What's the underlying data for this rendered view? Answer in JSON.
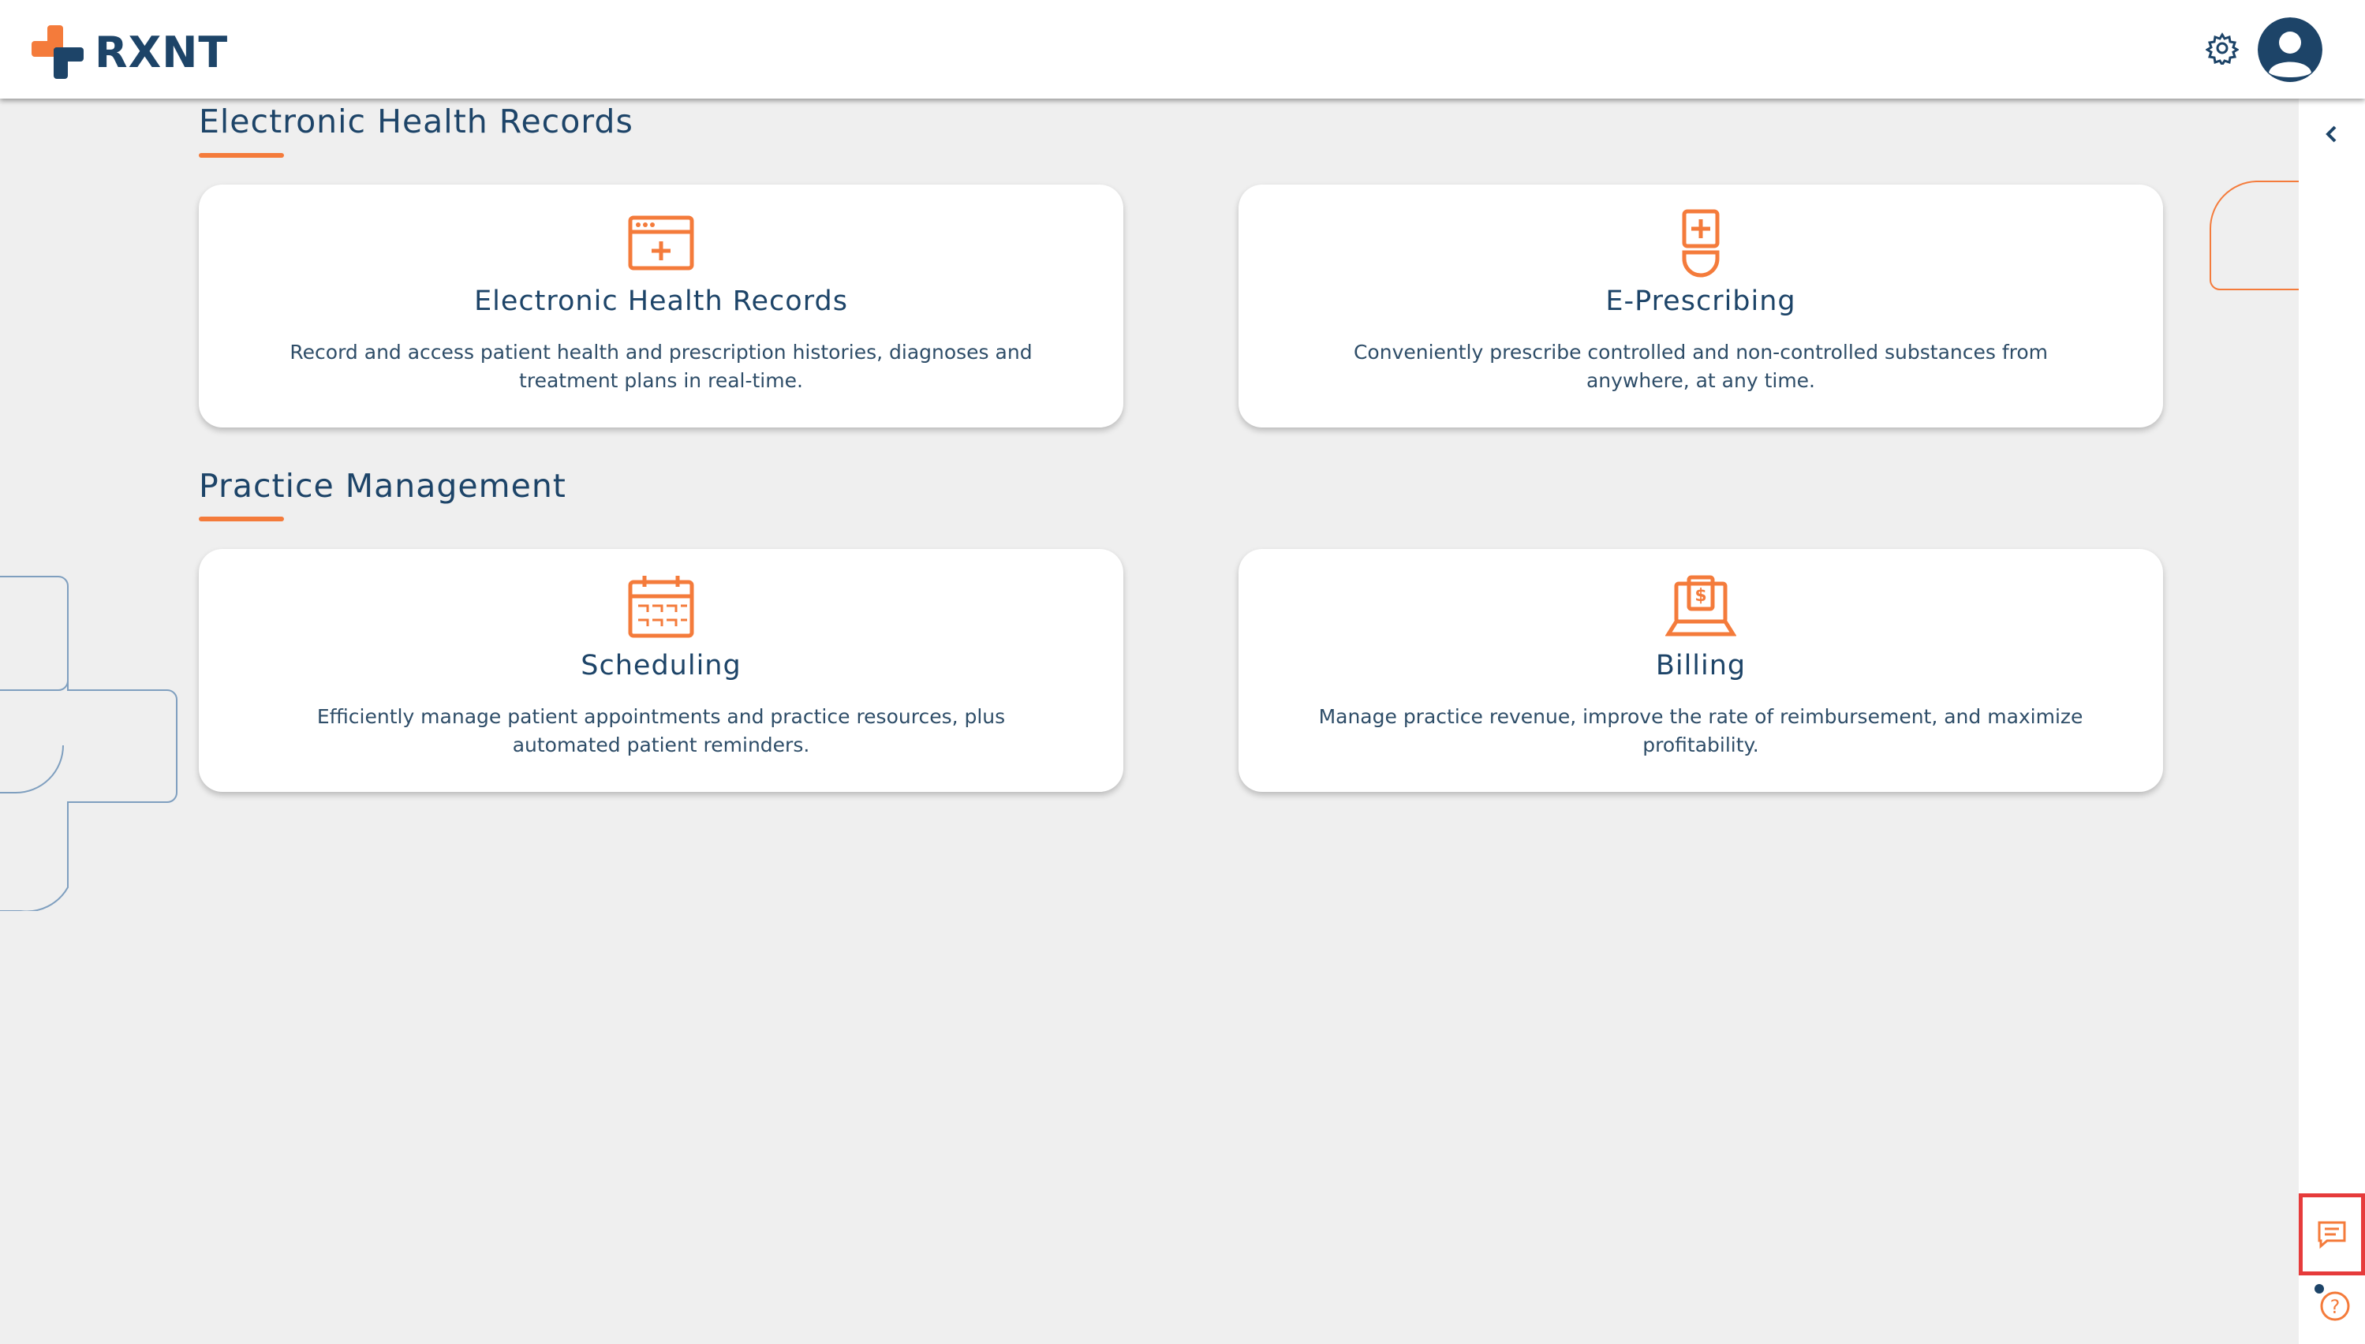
{
  "header": {
    "logo_text": "RXNT"
  },
  "sections": [
    {
      "title": "Electronic Health Records",
      "cards": [
        {
          "title": "Electronic Health Records",
          "description": "Record and access patient health and prescription histories, diagnoses and treatment plans in real-time.",
          "icon": "ehr-browser-icon"
        },
        {
          "title": "E-Prescribing",
          "description": "Conveniently prescribe controlled and non-controlled substances from anywhere, at any time.",
          "icon": "prescription-bottle-icon"
        }
      ]
    },
    {
      "title": "Practice Management",
      "cards": [
        {
          "title": "Scheduling",
          "description": "Efficiently manage patient appointments and practice resources, plus automated patient reminders.",
          "icon": "calendar-icon"
        },
        {
          "title": "Billing",
          "description": "Manage practice revenue, improve the rate of reimbursement, and maximize profitability.",
          "icon": "billing-laptop-icon"
        }
      ]
    }
  ],
  "colors": {
    "accent": "#f47b3b",
    "brand": "#1d4468",
    "background": "#efefef",
    "highlight": "#e63b3b"
  }
}
